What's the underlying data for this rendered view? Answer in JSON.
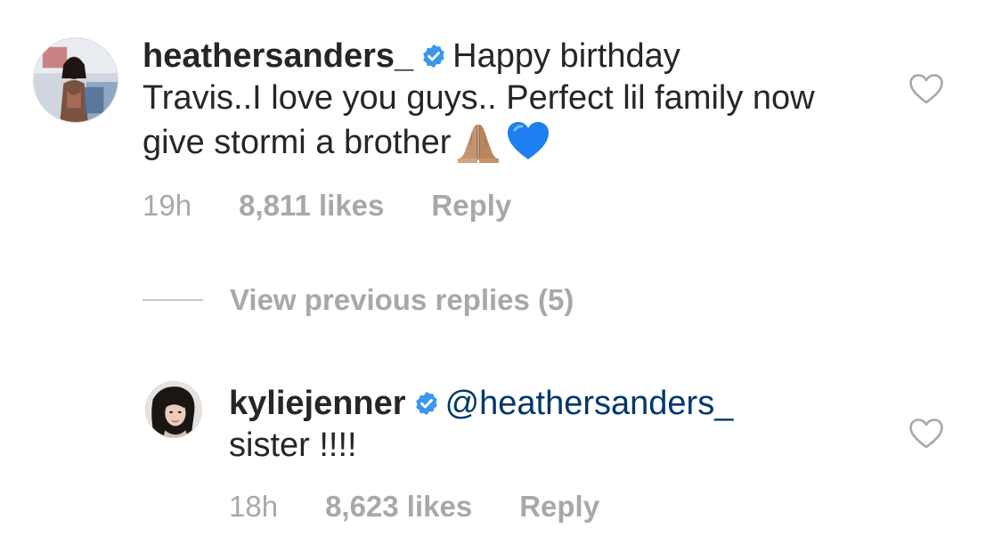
{
  "comment": {
    "username": "heathersanders_",
    "verified": true,
    "text_line1": "Happy birthday",
    "text_rest": "Travis..I love you guys.. Perfect lil family now give stormi a brother",
    "emojis": [
      "folded-hands-emoji",
      "blue-heart-emoji"
    ],
    "time": "19h",
    "likes": "8,811 likes",
    "reply_label": "Reply"
  },
  "view_previous_replies": "View previous replies (5)",
  "reply": {
    "username": "kyliejenner",
    "verified": true,
    "mention": "@heathersanders_",
    "text": "sister !!!!",
    "time": "18h",
    "likes": "8,623 likes",
    "reply_label": "Reply"
  },
  "colors": {
    "text": "#262626",
    "meta": "#a8a8a8",
    "mention": "#00376b",
    "verified_badge": "#3897f0"
  }
}
